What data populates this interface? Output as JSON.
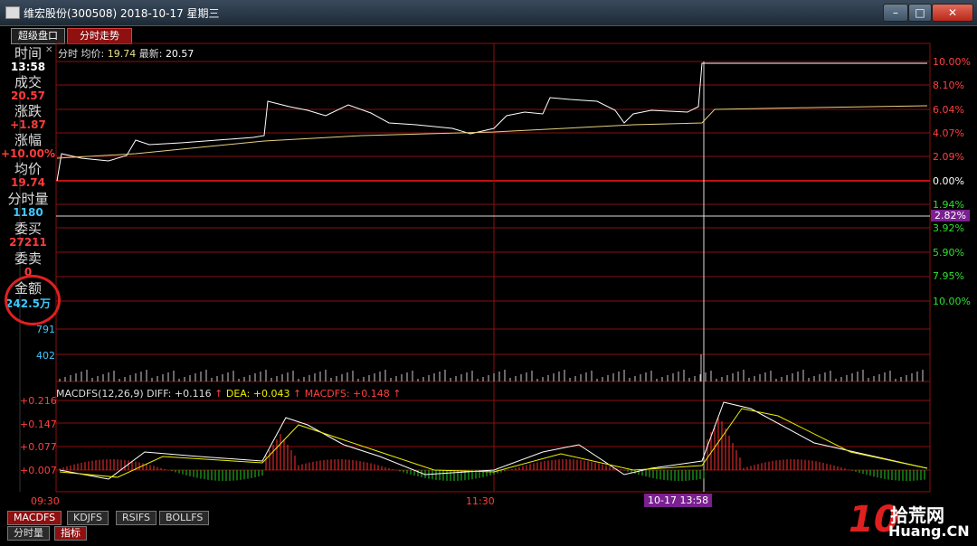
{
  "window": {
    "title": "维宏股份(300508) 2018-10-17 星期三",
    "min_label": "–",
    "max_label": "□",
    "close_label": "✕"
  },
  "tabs": [
    {
      "label": "超级盘口"
    },
    {
      "label": "分时走势"
    }
  ],
  "left_panel": {
    "time_label": "时间",
    "time_value": "13:58",
    "deal_label": "成交",
    "deal_value": "20.57",
    "change_label": "涨跌",
    "change_value": "+1.87",
    "pct_label": "涨幅",
    "pct_value": "+10.00%",
    "avg_label": "均价",
    "avg_value": "19.74",
    "vol_label": "分时量",
    "vol_value": "1180",
    "bid_label": "委买",
    "bid_value": "27211",
    "ask_label": "委卖",
    "ask_value": "0",
    "amount_label": "金额",
    "amount_value": "242.5万"
  },
  "header": {
    "prefix": "分时",
    "avg_label": "均价:",
    "avg_value": "19.74",
    "latest_label": "最新:",
    "latest_value": "20.57"
  },
  "right_axis": {
    "up": [
      "10.00%",
      "8.10%",
      "6.04%",
      "4.07%",
      "2.09%"
    ],
    "zero": "0.00%",
    "down": [
      "1.94%",
      "3.92%",
      "5.90%",
      "7.95%",
      "10.00%"
    ],
    "cursor": "2.82%"
  },
  "volume_axis": [
    "791",
    "402"
  ],
  "macd": {
    "title": "MACDFS(12,26,9)",
    "diff_label": "DIFF:",
    "diff_value": "+0.116",
    "dea_label": "DEA:",
    "dea_value": "+0.043",
    "macdfs_label": "MACDFS:",
    "macdfs_value": "+0.148",
    "arrow": "↑",
    "axis": [
      "+0.216",
      "+0.147",
      "+0.077",
      "+0.007"
    ]
  },
  "time_axis": {
    "start": "09:30",
    "mid": "11:30",
    "cursor": "10-17 13:58"
  },
  "bottom_tabs": [
    "MACDFS",
    "KDJFS",
    "RSIFS",
    "BOLLFS"
  ],
  "bottom_tabs2": [
    "分时量",
    "指标"
  ],
  "logo": {
    "mark": "10",
    "name": "拾荒网",
    "url": "Huang.CN"
  },
  "colors": {
    "grid": "#8a1010",
    "price": "#ffffff",
    "avg": "#e8d080",
    "up": "#ff3030",
    "down": "#22cc22",
    "diff": "#ffffff",
    "dea": "#f0f000"
  }
}
